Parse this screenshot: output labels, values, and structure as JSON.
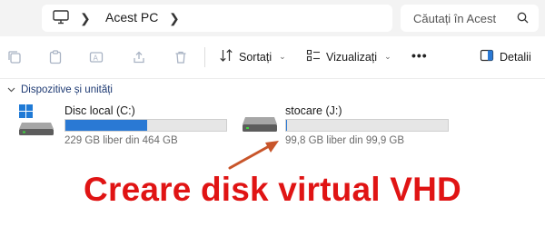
{
  "address_bar": {
    "location": "Acest PC",
    "search_placeholder": "Căutați în Acest"
  },
  "toolbar": {
    "sort_label": "Sortați",
    "view_label": "Vizualizați",
    "more_label": "•••",
    "details_label": "Detalii"
  },
  "section": {
    "title": "Dispozitive și unități"
  },
  "drives": [
    {
      "name": "Disc local (C:)",
      "space_text": "229 GB liber din 464 GB",
      "used_fraction": 0.51
    },
    {
      "name": "stocare (J:)",
      "space_text": "99,8 GB liber din 99,9 GB",
      "used_fraction": 0.001
    }
  ],
  "overlay": {
    "headline": "Creare disk virtual VHD",
    "color": "#e01414"
  },
  "colors": {
    "accent": "#2a79d4",
    "arrow": "#c8552a"
  }
}
